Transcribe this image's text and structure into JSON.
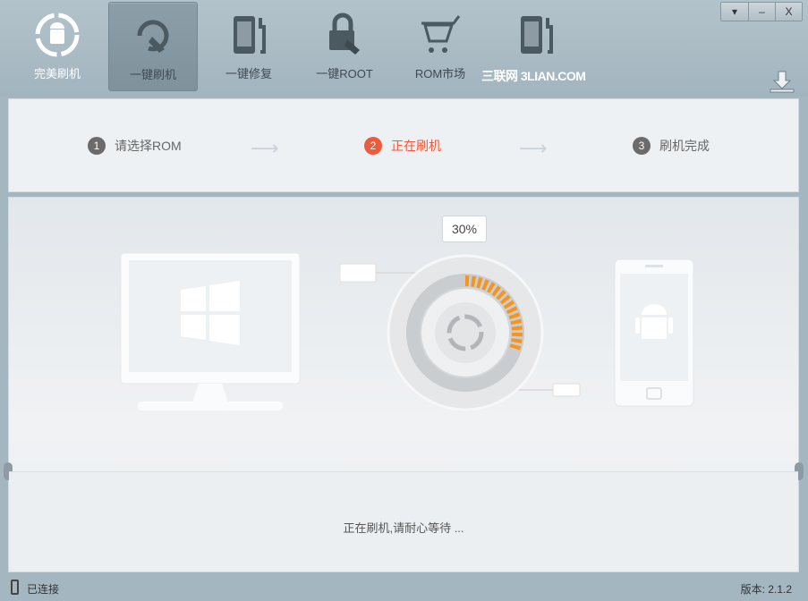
{
  "nav": [
    {
      "label": "完美刷机",
      "icon": "android-refresh-icon"
    },
    {
      "label": "一键刷机",
      "icon": "refresh-hand-icon"
    },
    {
      "label": "一键修复",
      "icon": "phone-wrench-icon"
    },
    {
      "label": "一键ROOT",
      "icon": "lock-hand-icon"
    },
    {
      "label": "ROM市场",
      "icon": "cart-icon"
    },
    {
      "label": "",
      "icon": "phone-wrench-icon"
    }
  ],
  "watermark": "三联网 3LIAN.COM",
  "window": {
    "menu": "▾",
    "minimize": "–",
    "close": "X"
  },
  "steps": [
    {
      "num": "1",
      "label": "请选择ROM"
    },
    {
      "num": "2",
      "label": "正在刷机"
    },
    {
      "num": "3",
      "label": "刷机完成"
    }
  ],
  "progress": {
    "percent_label": "30%",
    "value": 30
  },
  "message": "正在刷机,请耐心等待 ...",
  "status": {
    "connection": "已连接",
    "version": "版本: 2.1.2"
  },
  "colors": {
    "accent": "#ef5a3a",
    "progress": "#f7941d"
  }
}
